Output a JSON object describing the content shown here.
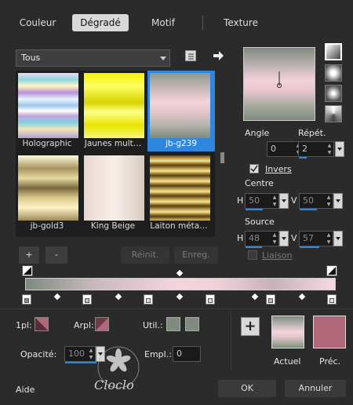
{
  "tabs": [
    {
      "label": "Couleur"
    },
    {
      "label": "Dégradé"
    },
    {
      "label": "Motif"
    },
    {
      "label": "Texture"
    }
  ],
  "category_dropdown": {
    "value": "Tous"
  },
  "gradients": [
    {
      "name": "Holographic"
    },
    {
      "name": "Jaunes mult…"
    },
    {
      "name": "jb-g239"
    },
    {
      "name": "jb-gold3"
    },
    {
      "name": "King Beige"
    },
    {
      "name": "Laiton méta…"
    }
  ],
  "controls": {
    "angle_label": "Angle",
    "angle_value": "0",
    "repeat_label": "Répét.",
    "repeat_value": "2",
    "invert_label": "Invers",
    "center_label": "Centre",
    "center_h": "50",
    "center_v": "50",
    "source_label": "Source",
    "source_h": "48",
    "source_v": "57",
    "h_label": "H",
    "v_label": "V",
    "link_label": "Liaison"
  },
  "buttons": {
    "add": "+",
    "remove": "-",
    "reset": "Réinit.",
    "save": "Enreg.",
    "ok": "OK",
    "cancel": "Annuler",
    "help": "Aide"
  },
  "stop_panel": {
    "first_label": "1pl:",
    "arpl_label": "Arpl:",
    "util_label": "Util.:",
    "opacity_label": "Opacité:",
    "opacity_value": "100",
    "empl_label": "Empl.:",
    "empl_value": "0",
    "current_label": "Actuel",
    "previous_label": "Préc."
  },
  "watermark": "Cloclo",
  "colors": {
    "accent": "#2e86de",
    "stop_color": "#b0687a",
    "mid_gray": "#7e8b7e",
    "light_pink": "#e5cdd3"
  }
}
